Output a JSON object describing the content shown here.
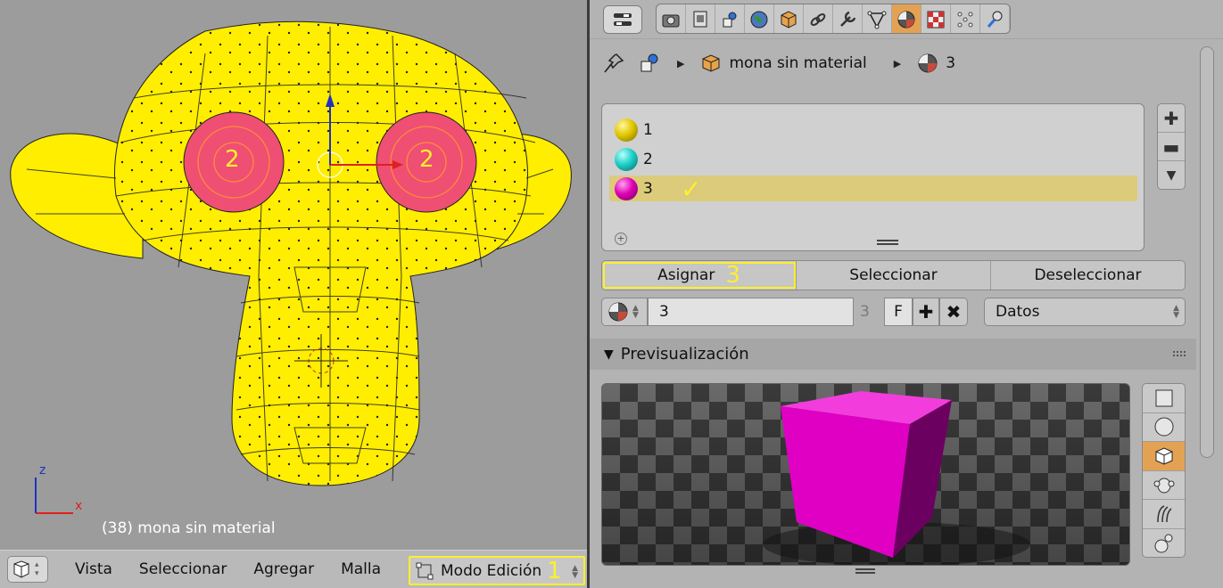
{
  "viewport": {
    "object_label": "(38) mona sin material",
    "axis_x": "x",
    "axis_z": "z",
    "eye_left_number": "2",
    "eye_right_number": "2",
    "mesh_color": "#ffee00",
    "eye_color": "#ef4f73"
  },
  "viewport_header": {
    "menu": [
      "Vista",
      "Seleccionar",
      "Agregar",
      "Malla"
    ],
    "mode": "Modo Edición",
    "mode_annotation": "1"
  },
  "properties": {
    "tabs": [
      "render-icon",
      "render-layers-icon",
      "scene-icon",
      "world-icon",
      "object-icon",
      "constraints-icon",
      "modifiers-icon",
      "data-icon",
      "material-icon",
      "texture-icon",
      "particles-icon",
      "physics-icon"
    ],
    "active_tab": "material-icon",
    "breadcrumb": {
      "object": "mona sin material",
      "material": "3"
    },
    "material_slots": [
      {
        "label": "1",
        "color": "#e2c700"
      },
      {
        "label": "2",
        "color": "#1ecfc9"
      },
      {
        "label": "3",
        "color": "#e000b5"
      }
    ],
    "selected_slot": "3",
    "buttons": {
      "assign": "Asignar",
      "select": "Seleccionar",
      "deselect": "Deseleccionar",
      "assign_annotation": "3"
    },
    "material_name": "3",
    "material_users": "3",
    "fake_user": "F",
    "link": "Datos",
    "preview_title": "Previsualización",
    "preview_shapes": [
      "plane-icon",
      "sphere-icon",
      "cube-icon",
      "monkey-icon",
      "hair-icon",
      "sphere-group-icon"
    ],
    "active_preview_shape": "cube-icon",
    "preview_color": "#e000c4"
  }
}
